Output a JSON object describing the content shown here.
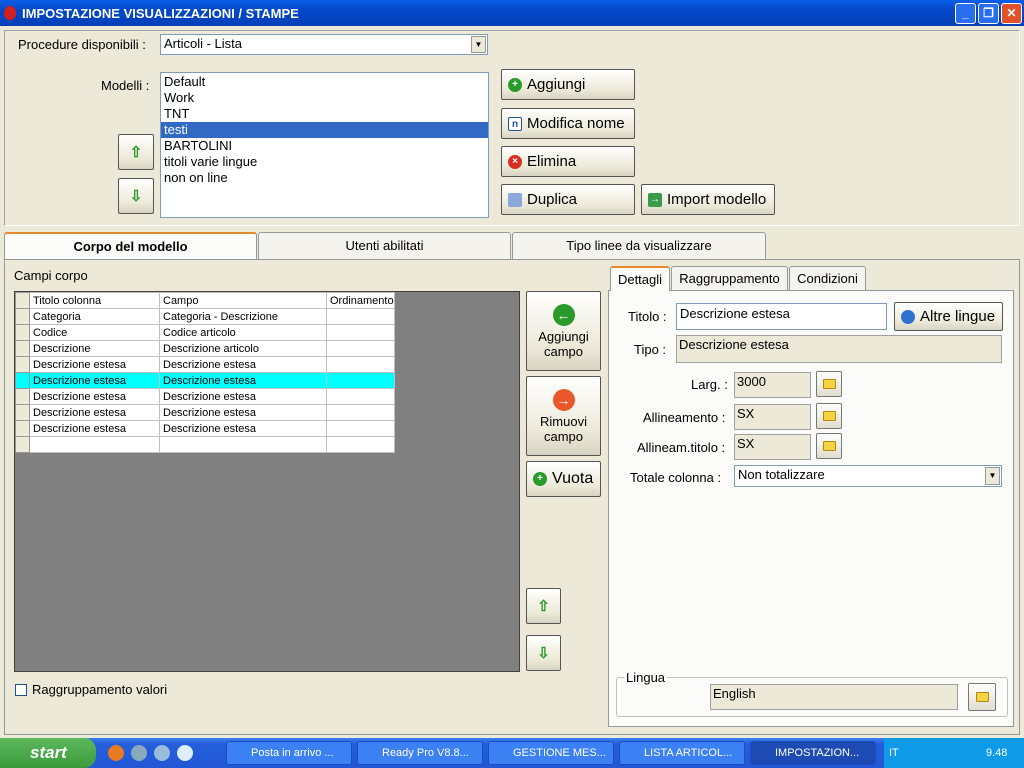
{
  "window": {
    "title": "IMPOSTAZIONE VISUALIZZAZIONI / STAMPE"
  },
  "top": {
    "procedure_label": "Procedure disponibili :",
    "procedure_value": "Articoli - Lista",
    "models_label": "Modelli :",
    "models": [
      "Default",
      "Work",
      "TNT",
      "testi",
      "BARTOLINI",
      "titoli varie lingue",
      "non on line"
    ],
    "selected_model": 3,
    "buttons": {
      "add": "Aggiungi",
      "rename": "Modifica nome",
      "delete": "Elimina",
      "duplicate": "Duplica",
      "import": "Import modello"
    }
  },
  "tabs": [
    "Corpo del modello",
    "Utenti abilitati",
    "Tipo linee da visualizzare"
  ],
  "body": {
    "fields_label": "Campi corpo",
    "columns": [
      "Titolo colonna",
      "Campo",
      "Ordinamento"
    ],
    "rows": [
      [
        "Categoria",
        "Categoria - Descrizione",
        ""
      ],
      [
        "Codice",
        "Codice articolo",
        ""
      ],
      [
        "Descrizione",
        "Descrizione articolo",
        ""
      ],
      [
        "Descrizione estesa",
        "Descrizione estesa",
        ""
      ],
      [
        "Descrizione estesa",
        "Descrizione estesa",
        ""
      ],
      [
        "Descrizione estesa",
        "Descrizione estesa",
        ""
      ],
      [
        "Descrizione estesa",
        "Descrizione estesa",
        ""
      ],
      [
        "Descrizione estesa",
        "Descrizione estesa",
        ""
      ]
    ],
    "highlight_row": 4,
    "add_field": "Aggiungi campo",
    "remove_field": "Rimuovi campo",
    "empty": "Vuota",
    "group_values": "Raggruppamento valori"
  },
  "details": {
    "tabs": [
      "Dettagli",
      "Raggruppamento",
      "Condizioni"
    ],
    "title_label": "Titolo :",
    "title_value": "Descrizione estesa",
    "other_lang": "Altre lingue",
    "type_label": "Tipo :",
    "type_value": "Descrizione estesa",
    "width_label": "Larg. :",
    "width_value": "3000",
    "align_label": "Allineamento :",
    "align_value": "SX",
    "align_title_label": "Allineam.titolo :",
    "align_title_value": "SX",
    "total_label": "Totale colonna :",
    "total_value": "Non totalizzare",
    "lang_group": "Lingua",
    "lang_value": "English"
  },
  "taskbar": {
    "start": "start",
    "items": [
      "Posta in arrivo ...",
      "Ready Pro V8.8...",
      "GESTIONE MES...",
      "LISTA ARTICOL...",
      "IMPOSTAZION..."
    ],
    "lang": "IT",
    "clock": "9.48"
  }
}
